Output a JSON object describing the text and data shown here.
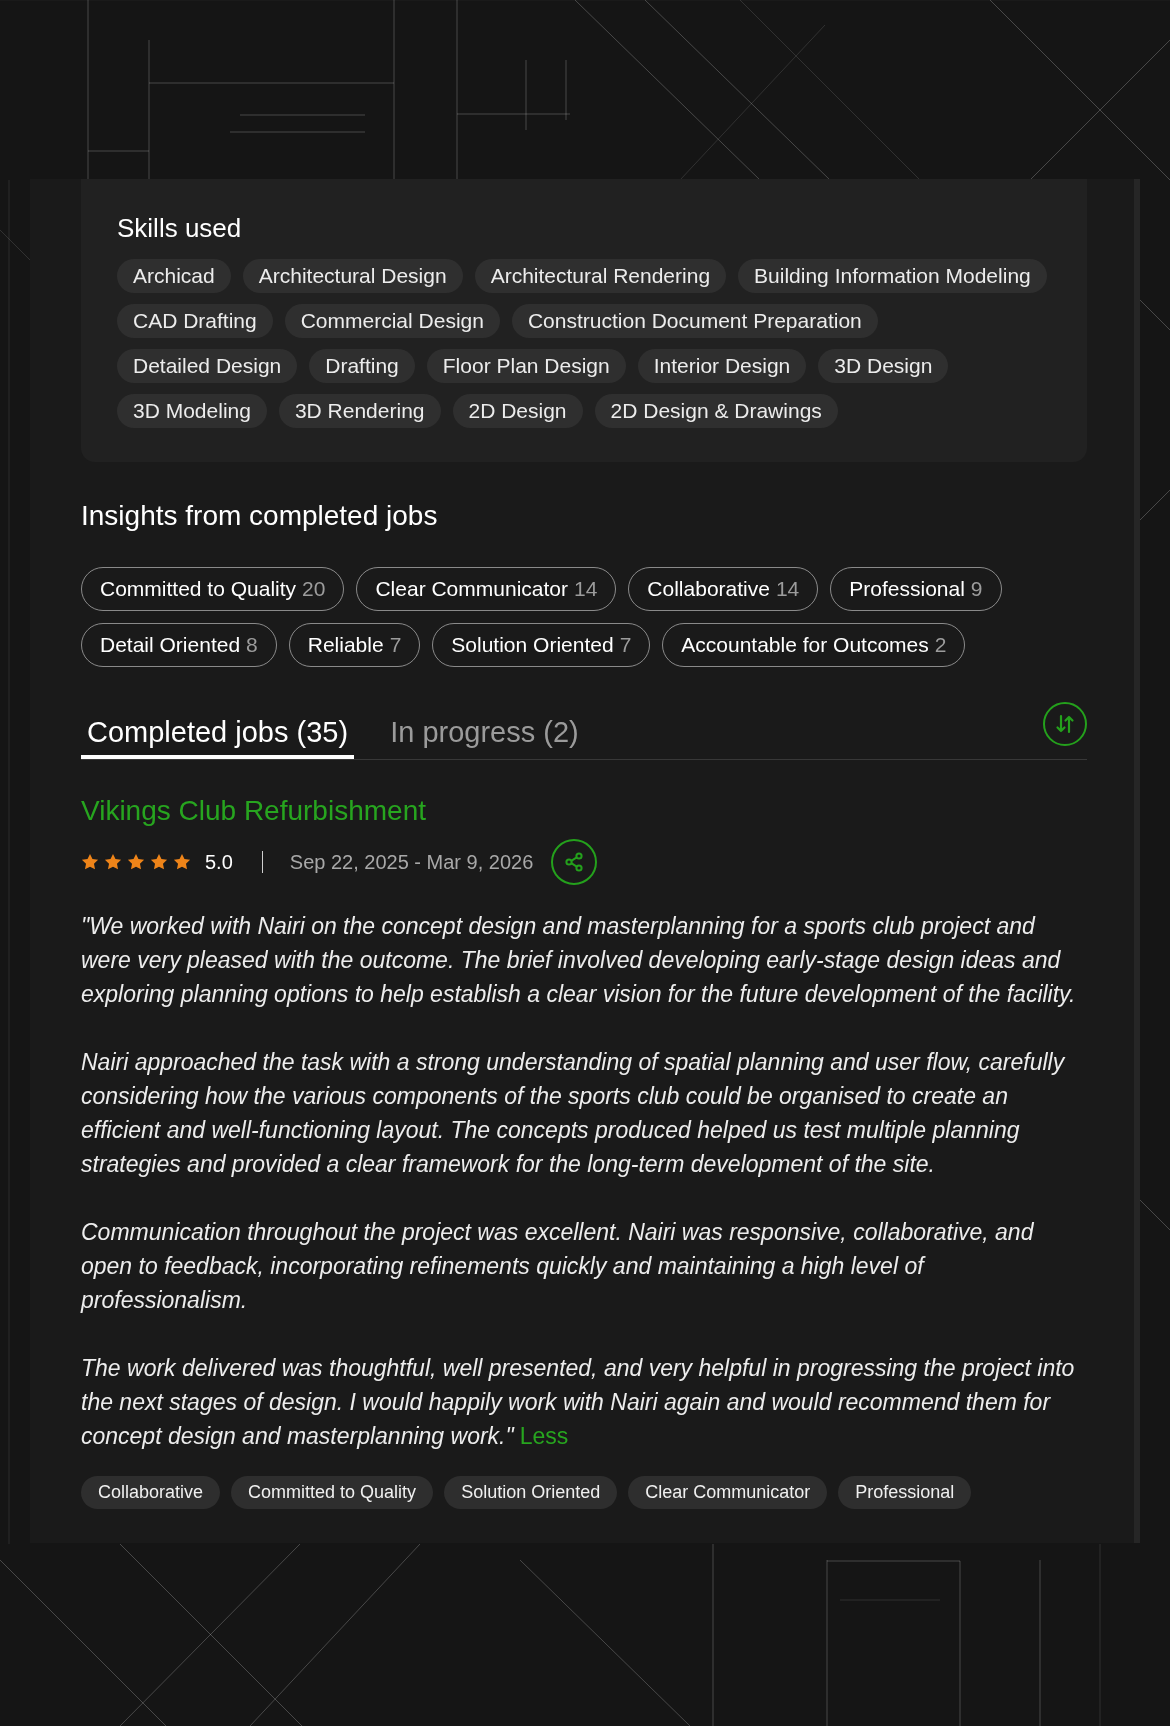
{
  "skills": {
    "title": "Skills used",
    "items": [
      "Archicad",
      "Architectural Design",
      "Architectural Rendering",
      "Building Information Modeling",
      "CAD Drafting",
      "Commercial Design",
      "Construction Document Preparation",
      "Detailed Design",
      "Drafting",
      "Floor Plan Design",
      "Interior Design",
      "3D Design",
      "3D Modeling",
      "3D Rendering",
      "2D Design",
      "2D Design & Drawings"
    ]
  },
  "insights": {
    "title": "Insights from completed jobs",
    "items": [
      {
        "label": "Committed to Quality",
        "count": "20"
      },
      {
        "label": "Clear Communicator",
        "count": "14"
      },
      {
        "label": "Collaborative",
        "count": "14"
      },
      {
        "label": "Professional",
        "count": "9"
      },
      {
        "label": "Detail Oriented",
        "count": "8"
      },
      {
        "label": "Reliable",
        "count": "7"
      },
      {
        "label": "Solution Oriented",
        "count": "7"
      },
      {
        "label": "Accountable for Outcomes",
        "count": "2"
      }
    ]
  },
  "tabs": [
    {
      "label": "Completed jobs (35)",
      "selected": true
    },
    {
      "label": "In progress (2)",
      "selected": false
    }
  ],
  "job": {
    "title": "Vikings Club Refurbishment",
    "stars": 5,
    "rating": "5.0",
    "dates": "Sep 22, 2025 - Mar 9, 2026",
    "review": [
      "\"We worked with Nairi on the concept design and masterplanning for a sports club project and were very pleased with the outcome. The brief involved developing early-stage design ideas and exploring planning options to help establish a clear vision for the future development of the facility.",
      "Nairi approached the task with a strong understanding of spatial planning and user flow, carefully considering how the various components of the sports club could be organised to create an efficient and well-functioning layout. The concepts produced helped us test multiple planning strategies and provided a clear framework for the long-term development of the site.",
      "Communication throughout the project was excellent. Nairi was responsive, collaborative, and open to feedback, incorporating refinements quickly and maintaining a high level of professionalism.",
      "The work delivered was thoughtful, well presented, and very helpful in progressing the project into the next stages of design. I would happily work with Nairi again and would recommend them for concept design and masterplanning work.\""
    ],
    "less_link": "Less",
    "tags": [
      "Collaborative",
      "Committed to Quality",
      "Solution Oriented",
      "Clear Communicator",
      "Professional"
    ]
  }
}
